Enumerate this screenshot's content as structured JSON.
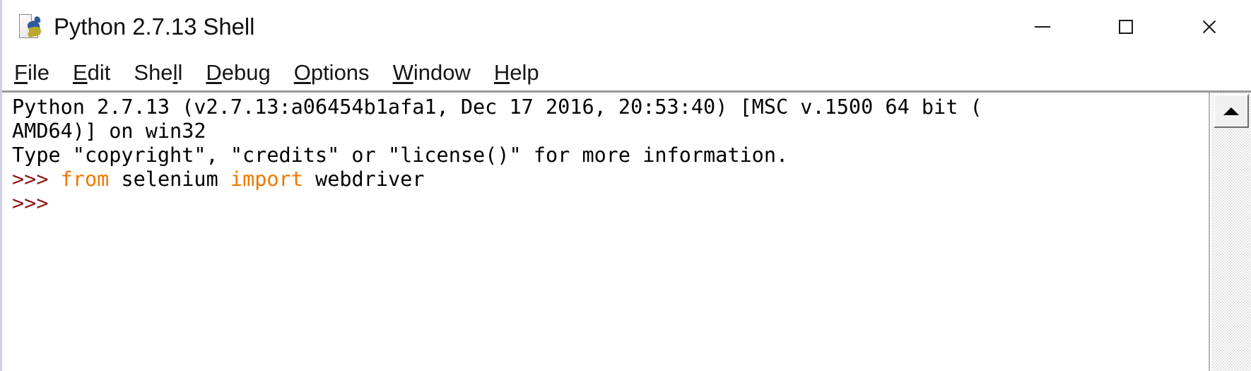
{
  "window": {
    "title": "Python 2.7.13 Shell",
    "icon": "python-document-icon",
    "controls": {
      "minimize": "minimize-icon",
      "maximize": "maximize-icon",
      "close": "close-icon"
    }
  },
  "menubar": {
    "items": [
      {
        "label": "File",
        "mnemonic": "F",
        "before": "",
        "after": "ile"
      },
      {
        "label": "Edit",
        "mnemonic": "E",
        "before": "",
        "after": "dit"
      },
      {
        "label": "Shell",
        "mnemonic": "l",
        "before": "She",
        "after": "l"
      },
      {
        "label": "Debug",
        "mnemonic": "D",
        "before": "",
        "after": "ebug"
      },
      {
        "label": "Options",
        "mnemonic": "O",
        "before": "",
        "after": "ptions"
      },
      {
        "label": "Window",
        "mnemonic": "W",
        "before": "",
        "after": "indow"
      },
      {
        "label": "Help",
        "mnemonic": "H",
        "before": "",
        "after": "elp"
      }
    ]
  },
  "shell": {
    "lines": [
      {
        "id": "banner1",
        "text": "Python 2.7.13 (v2.7.13:a06454b1afa1, Dec 17 2016, 20:53:40) [MSC v.1500 64 bit ("
      },
      {
        "id": "banner2",
        "text": "AMD64)] on win32"
      },
      {
        "id": "banner3",
        "text": "Type \"copyright\", \"credits\" or \"license()\" for more information."
      }
    ],
    "prompt": ">>>",
    "input_line": {
      "prompt": ">>>",
      "keyword1": "from",
      "module": "selenium",
      "keyword2": "import",
      "name": "webdriver"
    },
    "empty_prompt": ">>>"
  },
  "scrollbar": {
    "up_arrow": "scroll-up-icon"
  },
  "colors": {
    "prompt": "#8b1a1a",
    "keyword": "#f07800",
    "text": "#000000",
    "background": "#ffffff"
  }
}
